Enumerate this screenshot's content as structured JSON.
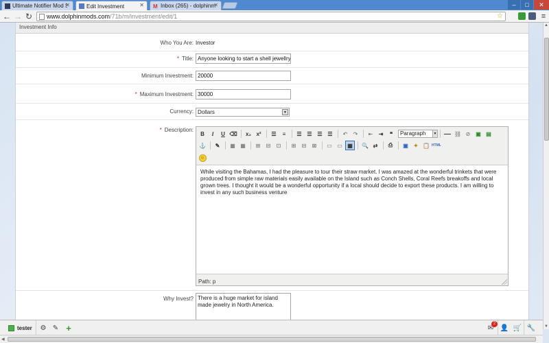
{
  "browser": {
    "tabs": [
      {
        "label": "Ultimate Notifier Mod Sup",
        "active": false
      },
      {
        "label": "Edit Investment",
        "active": true
      },
      {
        "label": "Inbox (265) - dolphinmod",
        "active": false
      }
    ],
    "url_domain": "www.dolphinmods.com",
    "url_path": "/71b/m/investment/edit/1"
  },
  "form": {
    "section_title": "Investment Info",
    "who_label": "Who You Are:",
    "who_value": "Investor",
    "title_label": "Title:",
    "title_value": "Anyone looking to start a shell jewellry",
    "min_label": "Minimum Investment:",
    "min_value": "20000",
    "max_label": "Maximum Investment:",
    "max_value": "30000",
    "currency_label": "Currency:",
    "currency_value": "Dollars",
    "description_label": "Description:",
    "editor": {
      "format_value": "Paragraph",
      "content": "While visiting the Bahamas, I had the pleasure to tour their straw market. I was amazed at the wonderful trinkets that were produced from simple raw materials easily available on the Island such as Conch Shells, Coral Reefs breakoffs and local grown trees. I thought it would be a wonderful opportunity if a local should decide to export these products. I am willing to invest in any such business venture",
      "path_label": "Path:",
      "path_value": "p"
    },
    "why_label": "Why Invest?",
    "why_value": "There is a huge market for island made jewelry in North America."
  },
  "bottombar": {
    "username": "tester",
    "notification_count": "2"
  },
  "colors": {
    "required": "#dd2222",
    "accent": "#316ac5",
    "brand_green": "#4cb04c"
  }
}
